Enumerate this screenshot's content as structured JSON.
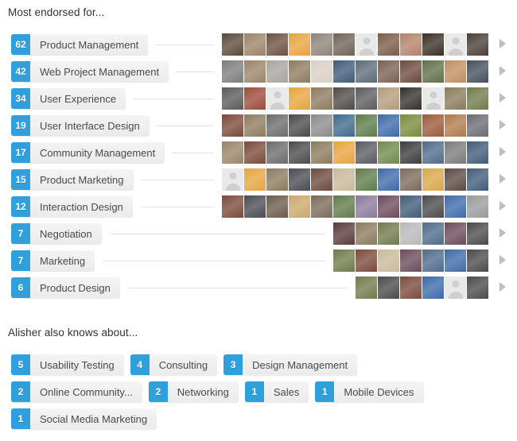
{
  "headings": {
    "most_endorsed": "Most endorsed for...",
    "also_knows": "Alisher also knows about..."
  },
  "colors": {
    "badge_blue": "#2fa0db",
    "pill_gray": "#f0f0f0",
    "text": "#4a4a4a",
    "arrow_gray": "#bdbdbd",
    "connector_line": "#e3e3e3"
  },
  "icons": {
    "next_arrow": "chevron-right-triangle"
  },
  "endorsements": [
    {
      "count": "62",
      "skill": "Product Management",
      "avatar_count": 11,
      "avatars": [
        {
          "type": "photo",
          "tone": "#5b4a3a"
        },
        {
          "type": "photo",
          "tone": "#9a8468"
        },
        {
          "type": "photo",
          "tone": "#6b5140"
        },
        {
          "type": "photo",
          "tone": "#e8a33d"
        },
        {
          "type": "photo",
          "tone": "#8d8478"
        },
        {
          "type": "photo",
          "tone": "#6f6257"
        },
        {
          "type": "placeholder",
          "tone": "#e9e9e9"
        },
        {
          "type": "photo",
          "tone": "#7a5b46"
        },
        {
          "type": "photo",
          "tone": "#b4826a"
        },
        {
          "type": "photo",
          "tone": "#3b2f28"
        },
        {
          "type": "placeholder",
          "tone": "#e9e9e9"
        },
        {
          "type": "photo",
          "tone": "#4a3e36"
        }
      ]
    },
    {
      "count": "42",
      "skill": "Web Project Management",
      "avatar_count": 11,
      "avatars": [
        {
          "type": "photo",
          "tone": "#7d7d7d"
        },
        {
          "type": "photo",
          "tone": "#9a8468"
        },
        {
          "type": "photo",
          "tone": "#a8a49e"
        },
        {
          "type": "photo",
          "tone": "#8d7a5e"
        },
        {
          "type": "photo",
          "tone": "#d8cfc4"
        },
        {
          "type": "photo",
          "tone": "#3f5b78"
        },
        {
          "type": "photo",
          "tone": "#5c6b78"
        },
        {
          "type": "photo",
          "tone": "#7a5f52"
        },
        {
          "type": "photo",
          "tone": "#6b4a3c"
        },
        {
          "type": "photo",
          "tone": "#5f6f4a"
        },
        {
          "type": "photo",
          "tone": "#c08f5e"
        },
        {
          "type": "photo",
          "tone": "#44505c"
        }
      ]
    },
    {
      "count": "34",
      "skill": "User Experience",
      "avatar_count": 11,
      "avatars": [
        {
          "type": "photo",
          "tone": "#5a5a5a"
        },
        {
          "type": "photo",
          "tone": "#9c4a3c"
        },
        {
          "type": "placeholder",
          "tone": "#e9e9e9"
        },
        {
          "type": "photo",
          "tone": "#e8a33d"
        },
        {
          "type": "photo",
          "tone": "#8d7a5e"
        },
        {
          "type": "photo",
          "tone": "#4f4a44"
        },
        {
          "type": "photo",
          "tone": "#5c5c5c"
        },
        {
          "type": "photo",
          "tone": "#b49a7c"
        },
        {
          "type": "photo",
          "tone": "#34302c"
        },
        {
          "type": "placeholder",
          "tone": "#e9e9e9"
        },
        {
          "type": "photo",
          "tone": "#8a7a5c"
        },
        {
          "type": "photo",
          "tone": "#6f7a4a"
        }
      ]
    },
    {
      "count": "19",
      "skill": "User Interface Design",
      "avatar_count": 11,
      "avatars": [
        {
          "type": "photo",
          "tone": "#7a4a3a"
        },
        {
          "type": "photo",
          "tone": "#8d7a5e"
        },
        {
          "type": "photo",
          "tone": "#6b6b6b"
        },
        {
          "type": "photo",
          "tone": "#4a4a4a"
        },
        {
          "type": "photo",
          "tone": "#8b8b8b"
        },
        {
          "type": "photo",
          "tone": "#3f6a8a"
        },
        {
          "type": "photo",
          "tone": "#5f7a4a"
        },
        {
          "type": "photo",
          "tone": "#3d6aa8"
        },
        {
          "type": "photo",
          "tone": "#7a8a3a"
        },
        {
          "type": "photo",
          "tone": "#9a5a3a"
        },
        {
          "type": "photo",
          "tone": "#b07a4a"
        },
        {
          "type": "photo",
          "tone": "#6a6a72"
        }
      ]
    },
    {
      "count": "17",
      "skill": "Community Management",
      "avatar_count": 11,
      "avatars": [
        {
          "type": "photo",
          "tone": "#9a8468"
        },
        {
          "type": "photo",
          "tone": "#7a4a3a"
        },
        {
          "type": "photo",
          "tone": "#6b6b6b"
        },
        {
          "type": "photo",
          "tone": "#4a4a4a"
        },
        {
          "type": "photo",
          "tone": "#8a7a5c"
        },
        {
          "type": "photo",
          "tone": "#e8a33d"
        },
        {
          "type": "photo",
          "tone": "#5a5a62"
        },
        {
          "type": "photo",
          "tone": "#6f8a4a"
        },
        {
          "type": "photo",
          "tone": "#3b3b3b"
        },
        {
          "type": "photo",
          "tone": "#4f6a8a"
        },
        {
          "type": "photo",
          "tone": "#7a7a7a"
        },
        {
          "type": "photo",
          "tone": "#3f5b78"
        }
      ]
    },
    {
      "count": "15",
      "skill": "Product Marketing",
      "avatar_count": 11,
      "avatars": [
        {
          "type": "placeholder",
          "tone": "#e9e9e9"
        },
        {
          "type": "photo",
          "tone": "#e8a33d"
        },
        {
          "type": "photo",
          "tone": "#8d7a5e"
        },
        {
          "type": "photo",
          "tone": "#4a4a52"
        },
        {
          "type": "photo",
          "tone": "#6b4a3c"
        },
        {
          "type": "photo",
          "tone": "#c9b89a"
        },
        {
          "type": "photo",
          "tone": "#5f7a4a"
        },
        {
          "type": "photo",
          "tone": "#3d6aa8"
        },
        {
          "type": "photo",
          "tone": "#7a6a5a"
        },
        {
          "type": "photo",
          "tone": "#d8a84a"
        },
        {
          "type": "photo",
          "tone": "#5a4a42"
        },
        {
          "type": "photo",
          "tone": "#3f5b78"
        }
      ]
    },
    {
      "count": "12",
      "skill": "Interaction Design",
      "avatar_count": 11,
      "avatars": [
        {
          "type": "photo",
          "tone": "#7a4a3a"
        },
        {
          "type": "photo",
          "tone": "#4a4a52"
        },
        {
          "type": "photo",
          "tone": "#6b5a4a"
        },
        {
          "type": "photo",
          "tone": "#c9a86a"
        },
        {
          "type": "photo",
          "tone": "#7a6a5a"
        },
        {
          "type": "photo",
          "tone": "#5f7a4a"
        },
        {
          "type": "photo",
          "tone": "#8a7a9a"
        },
        {
          "type": "photo",
          "tone": "#6b4a5a"
        },
        {
          "type": "photo",
          "tone": "#3f5b78"
        },
        {
          "type": "photo",
          "tone": "#4a4a4a"
        },
        {
          "type": "photo",
          "tone": "#3d6aa8"
        },
        {
          "type": "photo",
          "tone": "#9a9a9a"
        }
      ]
    },
    {
      "count": "7",
      "skill": "Negotiation",
      "avatar_count": 7,
      "avatars": [
        {
          "type": "photo",
          "tone": "#5a3a3a"
        },
        {
          "type": "photo",
          "tone": "#8a7a5c"
        },
        {
          "type": "photo",
          "tone": "#6f7a4a"
        },
        {
          "type": "photo",
          "tone": "#b8b8b8"
        },
        {
          "type": "photo",
          "tone": "#4f6a8a"
        },
        {
          "type": "photo",
          "tone": "#6b4a5a"
        },
        {
          "type": "photo",
          "tone": "#4a4a4a"
        }
      ]
    },
    {
      "count": "7",
      "skill": "Marketing",
      "avatar_count": 7,
      "avatars": [
        {
          "type": "photo",
          "tone": "#6f7a4a"
        },
        {
          "type": "photo",
          "tone": "#7a4a3a"
        },
        {
          "type": "photo",
          "tone": "#c9b89a"
        },
        {
          "type": "photo",
          "tone": "#6b4a5a"
        },
        {
          "type": "photo",
          "tone": "#4f6a8a"
        },
        {
          "type": "photo",
          "tone": "#3d6aa8"
        },
        {
          "type": "photo",
          "tone": "#4a4a4a"
        }
      ]
    },
    {
      "count": "6",
      "skill": "Product Design",
      "avatar_count": 6,
      "avatars": [
        {
          "type": "photo",
          "tone": "#6f7a4a"
        },
        {
          "type": "photo",
          "tone": "#4a4a4a"
        },
        {
          "type": "photo",
          "tone": "#7a4a3a"
        },
        {
          "type": "photo",
          "tone": "#3d6aa8"
        },
        {
          "type": "placeholder",
          "tone": "#e9e9e9"
        },
        {
          "type": "photo",
          "tone": "#4a4a4a"
        }
      ]
    }
  ],
  "also_knows": [
    [
      {
        "count": "5",
        "skill": "Usability Testing"
      },
      {
        "count": "4",
        "skill": "Consulting"
      },
      {
        "count": "3",
        "skill": "Design Management"
      }
    ],
    [
      {
        "count": "2",
        "skill": "Online Community..."
      },
      {
        "count": "2",
        "skill": "Networking"
      },
      {
        "count": "1",
        "skill": "Sales"
      },
      {
        "count": "1",
        "skill": "Mobile Devices"
      }
    ],
    [
      {
        "count": "1",
        "skill": "Social Media Marketing"
      }
    ]
  ]
}
